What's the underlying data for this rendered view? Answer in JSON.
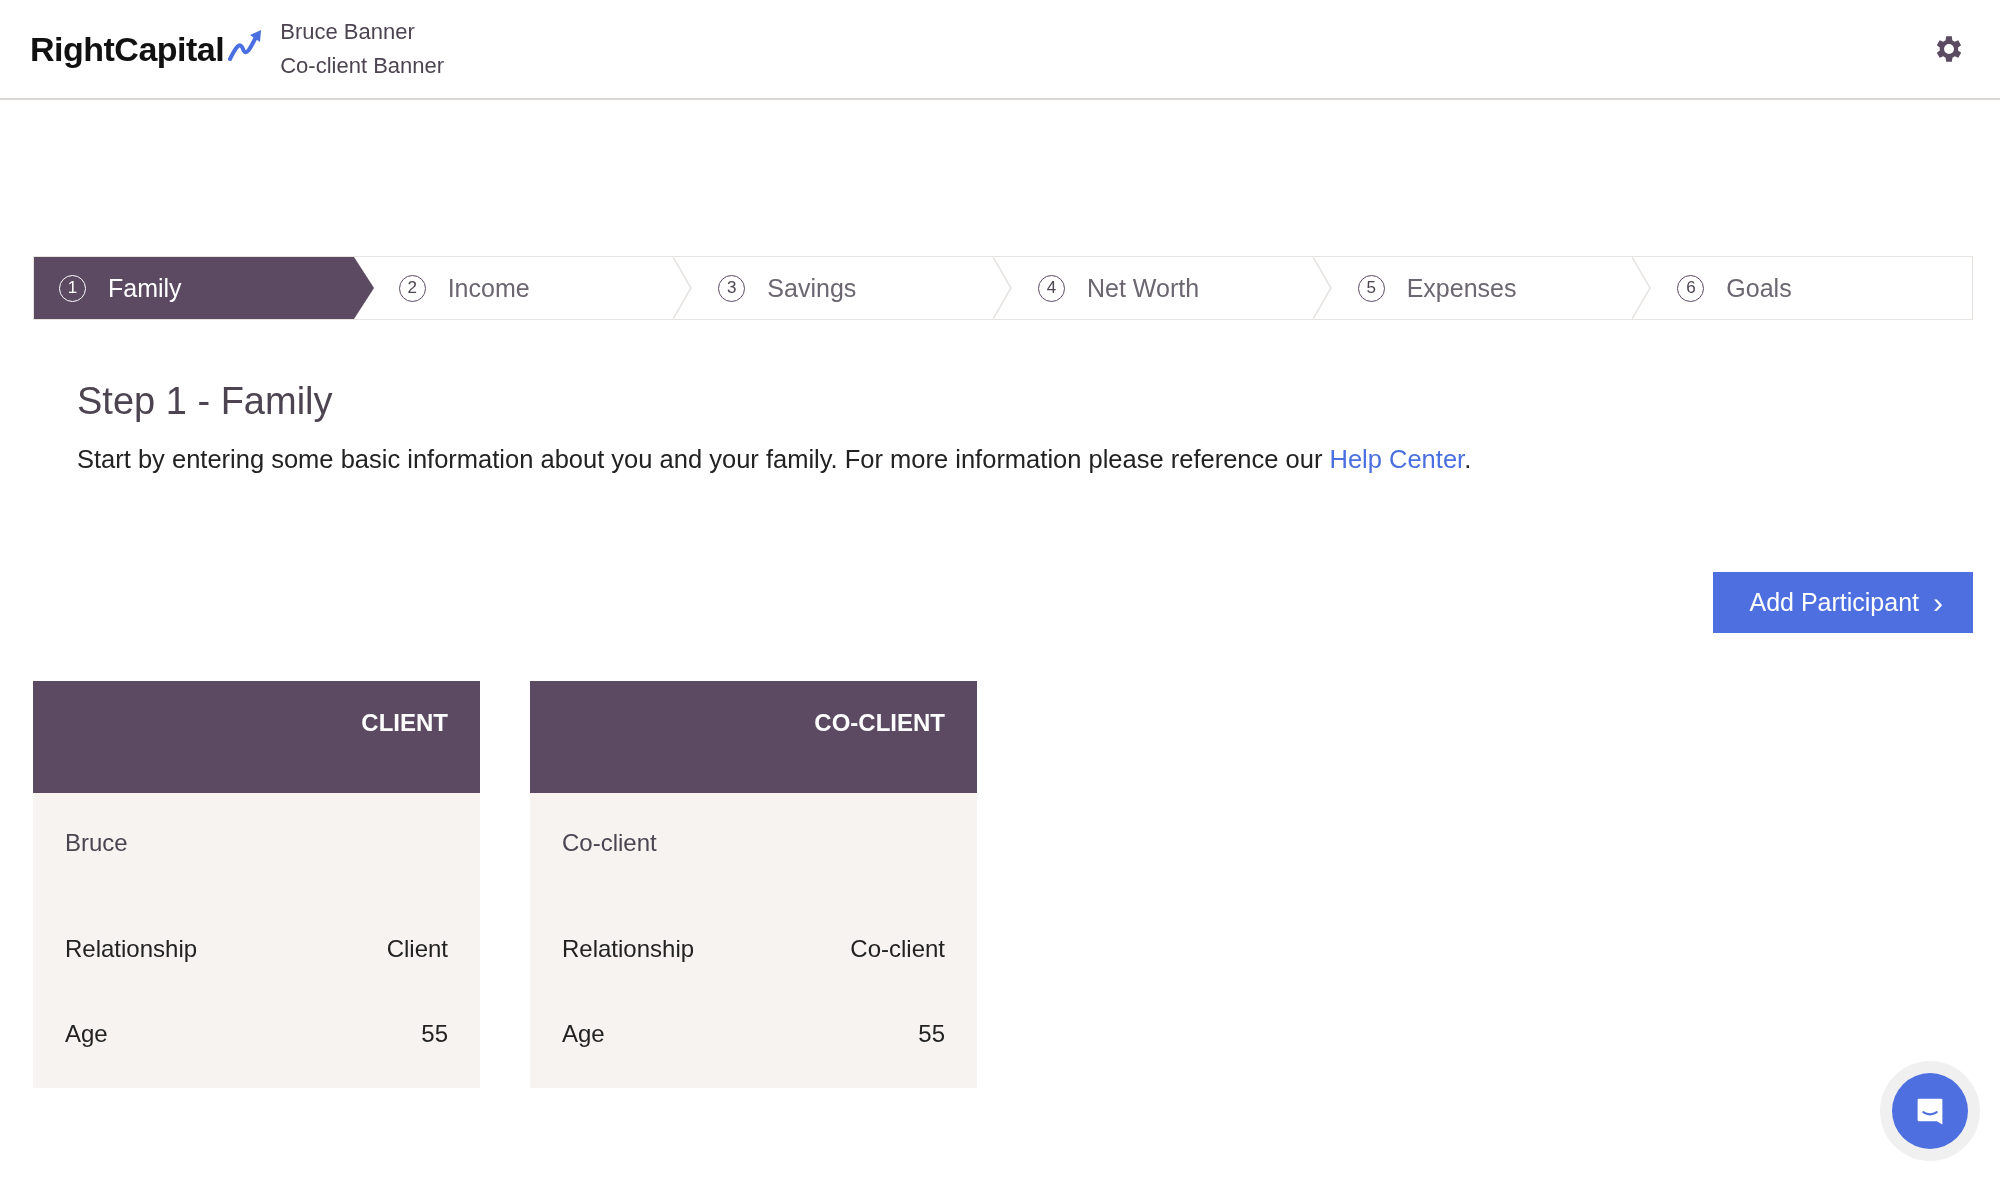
{
  "header": {
    "logo": "RightCapital",
    "client_names": [
      "Bruce Banner",
      "Co-client Banner"
    ]
  },
  "steps": [
    {
      "number": "1",
      "label": "Family",
      "selected": true
    },
    {
      "number": "2",
      "label": "Income",
      "selected": false
    },
    {
      "number": "3",
      "label": "Savings",
      "selected": false
    },
    {
      "number": "4",
      "label": "Net Worth",
      "selected": false
    },
    {
      "number": "5",
      "label": "Expenses",
      "selected": false
    },
    {
      "number": "6",
      "label": "Goals",
      "selected": false
    }
  ],
  "heading": "Step 1 - Family",
  "intro": {
    "text": "Start by entering some basic information about you and your family. For more information please reference our ",
    "link": "Help Center",
    "after": "."
  },
  "add_button": {
    "label": "Add Participant",
    "icon": "›"
  },
  "cards": [
    {
      "role": "CLIENT",
      "name": "Bruce",
      "rows": [
        {
          "label": "Relationship",
          "value": "Client"
        },
        {
          "label": "Age",
          "value": "55"
        }
      ]
    },
    {
      "role": "CO-CLIENT",
      "name": "Co-client",
      "rows": [
        {
          "label": "Relationship",
          "value": "Co-client"
        },
        {
          "label": "Age",
          "value": "55"
        }
      ]
    }
  ]
}
